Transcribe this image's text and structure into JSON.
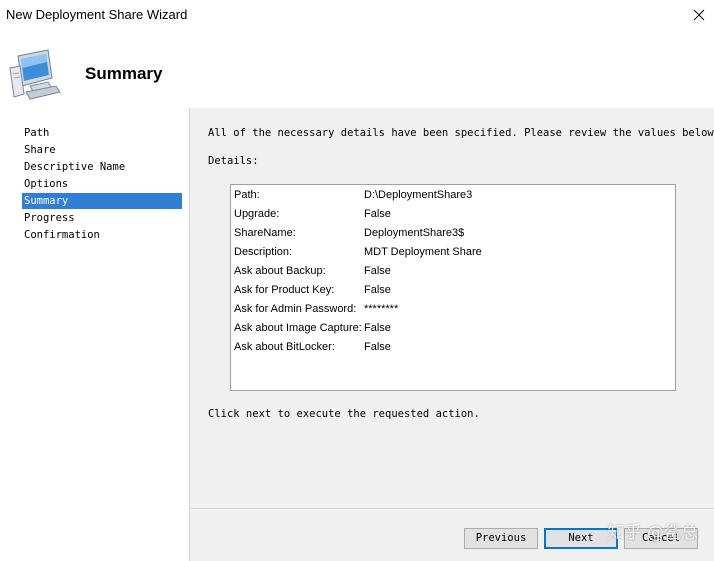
{
  "window": {
    "title": "New Deployment Share Wizard"
  },
  "header": {
    "icon": "computer-icon",
    "title": "Summary"
  },
  "sidebar": {
    "items": [
      {
        "label": "Path"
      },
      {
        "label": "Share"
      },
      {
        "label": "Descriptive Name"
      },
      {
        "label": "Options"
      },
      {
        "label": "Summary",
        "active": true
      },
      {
        "label": "Progress"
      },
      {
        "label": "Confirmation"
      }
    ],
    "active_color": "#2f7fd6"
  },
  "content": {
    "intro": "All of the necessary details have been specified.  Please review the values below.",
    "details_label": "Details:",
    "details": [
      {
        "key": "Path:",
        "value": "D:\\DeploymentShare3"
      },
      {
        "key": "Upgrade:",
        "value": "False"
      },
      {
        "key": "ShareName:",
        "value": "DeploymentShare3$"
      },
      {
        "key": "Description:",
        "value": "MDT Deployment Share"
      },
      {
        "key": "Ask about Backup:",
        "value": "False"
      },
      {
        "key": "Ask for Product Key:",
        "value": "False"
      },
      {
        "key": "Ask for Admin Password:",
        "value": "********"
      },
      {
        "key": "Ask about Image Capture:",
        "value": "False"
      },
      {
        "key": "Ask about BitLocker:",
        "value": "False"
      }
    ],
    "next_hint": "Click next to execute the requested action."
  },
  "footer": {
    "previous_label": "Previous",
    "next_label": "Next",
    "cancel_label": "Cancel"
  },
  "watermark": "知乎 @鲨总"
}
